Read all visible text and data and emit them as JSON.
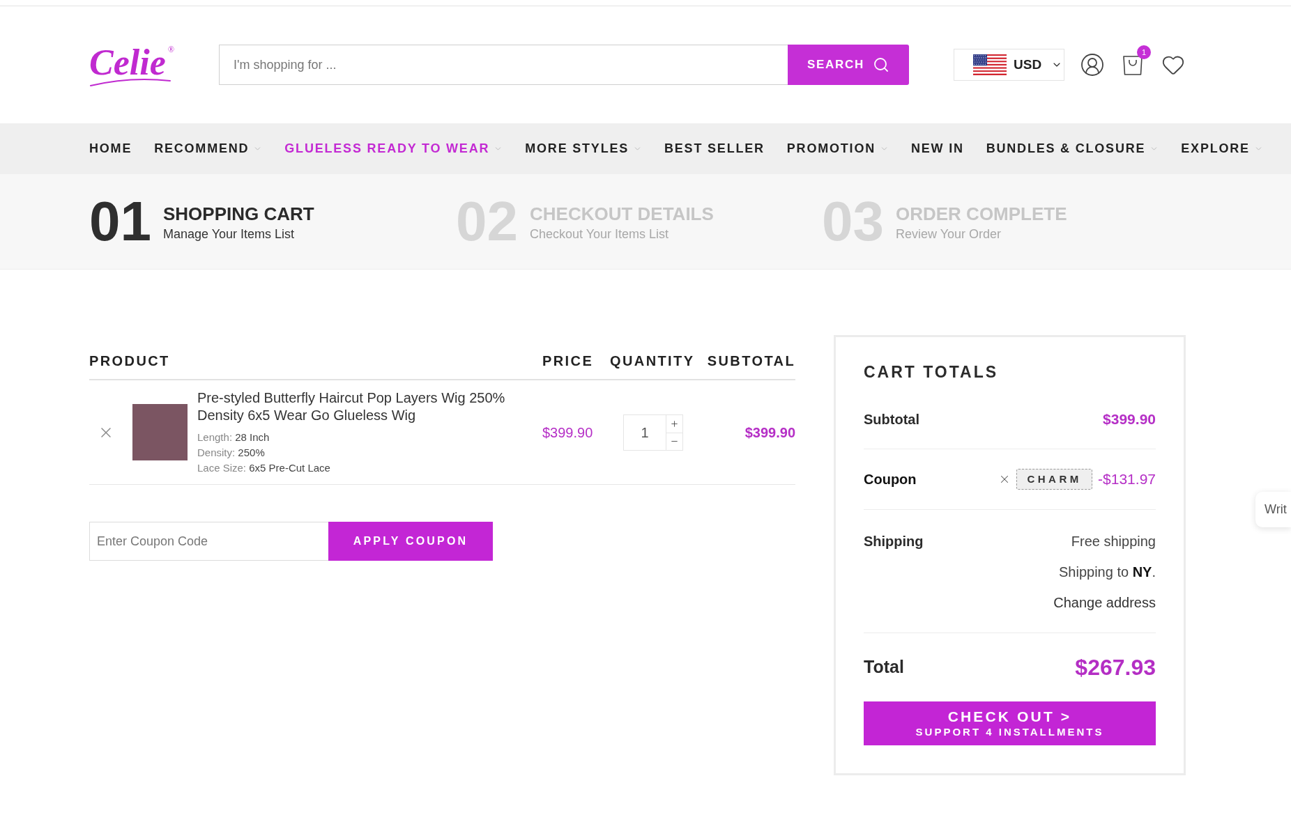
{
  "header": {
    "logo": {
      "text": "Celie",
      "mark": "®"
    },
    "search": {
      "placeholder": "I'm shopping for ...",
      "button": "SEARCH"
    },
    "currency": {
      "code": "USD"
    },
    "cart_badge": "1"
  },
  "nav": [
    {
      "label": "HOME",
      "selected": false,
      "dropdown": false
    },
    {
      "label": "RECOMMEND",
      "selected": false,
      "dropdown": true
    },
    {
      "label": "GLUELESS READY TO WEAR",
      "selected": true,
      "dropdown": true
    },
    {
      "label": "MORE STYLES",
      "selected": false,
      "dropdown": true
    },
    {
      "label": "BEST SELLER",
      "selected": false,
      "dropdown": false
    },
    {
      "label": "PROMOTION",
      "selected": false,
      "dropdown": true
    },
    {
      "label": "NEW IN",
      "selected": false,
      "dropdown": false
    },
    {
      "label": "BUNDLES & CLOSURE",
      "selected": false,
      "dropdown": true
    },
    {
      "label": "EXPLORE",
      "selected": false,
      "dropdown": true
    }
  ],
  "steps": [
    {
      "number": "01",
      "title": "SHOPPING CART",
      "subtitle": "Manage Your Items List",
      "active": true
    },
    {
      "number": "02",
      "title": "CHECKOUT DETAILS",
      "subtitle": "Checkout Your Items List",
      "active": false
    },
    {
      "number": "03",
      "title": "ORDER COMPLETE",
      "subtitle": "Review Your Order",
      "active": false
    }
  ],
  "cart": {
    "columns": [
      "PRODUCT",
      "PRICE",
      "QUANTITY",
      "SUBTOTAL"
    ],
    "items": [
      {
        "title": "Pre-styled Butterfly Haircut Pop Layers Wig 250% Density 6x5 Wear Go Glueless Wig",
        "options": [
          {
            "label": "Length:",
            "value": "28 Inch"
          },
          {
            "label": "Density:",
            "value": "250%"
          },
          {
            "label": "Lace Size:",
            "value": "6x5 Pre-Cut Lace"
          }
        ],
        "price": "$399.90",
        "quantity": "1",
        "subtotal": "$399.90"
      }
    ],
    "coupon": {
      "placeholder": "Enter Coupon Code",
      "button": "APPLY COUPON"
    }
  },
  "totals": {
    "title": "CART TOTALS",
    "subtotal": {
      "label": "Subtotal",
      "value": "$399.90"
    },
    "coupon": {
      "label": "Coupon",
      "code": "CHARM",
      "value": "-$131.97"
    },
    "shipping": {
      "label": "Shipping",
      "lines": [
        {
          "kind": "text",
          "text": "Free shipping"
        },
        {
          "kind": "text",
          "text": "Shipping to **NY**."
        },
        {
          "kind": "link",
          "text": "Change address"
        }
      ]
    },
    "total": {
      "label": "Total",
      "value": "$267.93"
    },
    "checkout": {
      "title": "CHECK OUT >",
      "subtitle": "SUPPORT 4 INSTALLMENTS"
    }
  },
  "side_tab": {
    "label": "Writ"
  }
}
